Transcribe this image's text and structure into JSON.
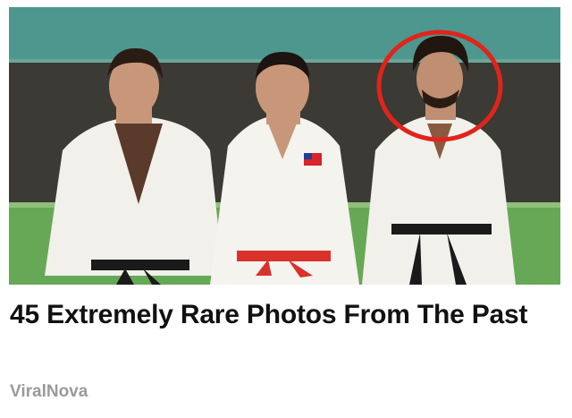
{
  "article": {
    "headline": "45 Extremely Rare Photos From The Past",
    "source": "ViralNova"
  },
  "colors": {
    "headline": "#111111",
    "source": "#9a9a9a",
    "highlight_circle": "#e0241b",
    "wall_top": "#4d978e",
    "wall_bottom": "#3b3a34",
    "floor": "#67a857"
  }
}
